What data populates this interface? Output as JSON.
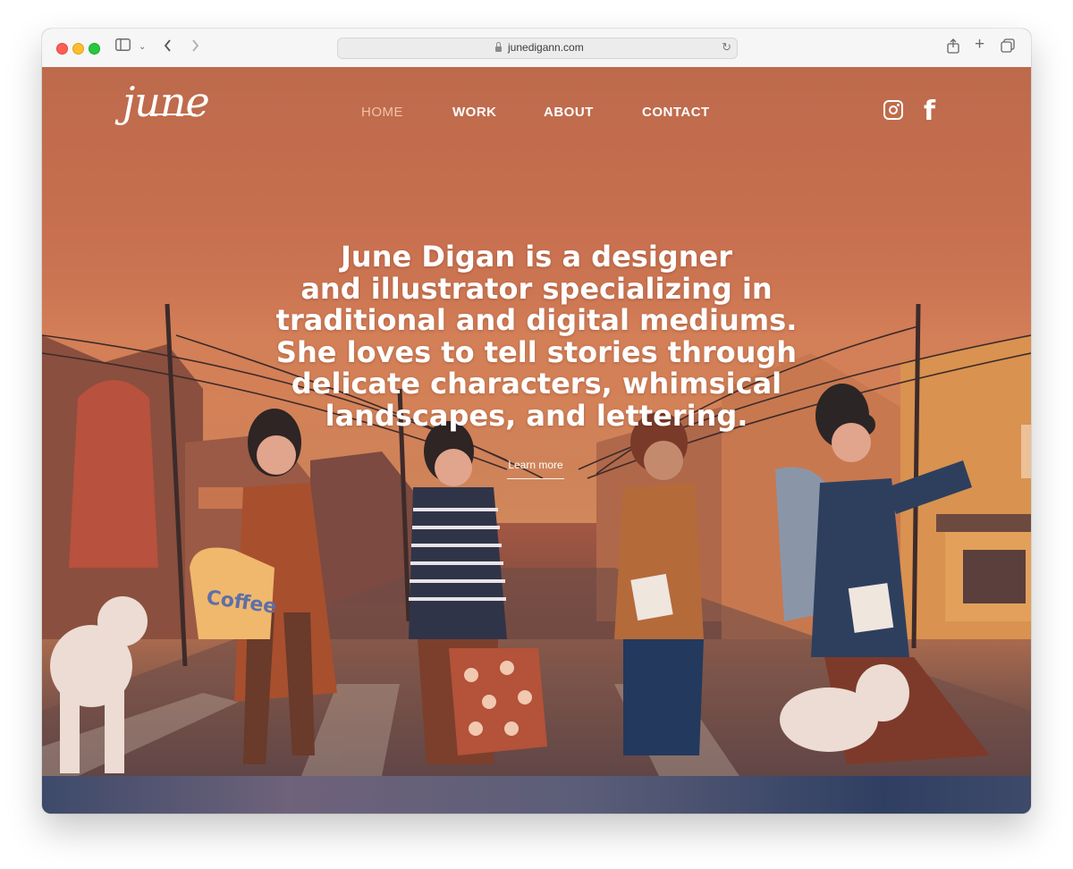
{
  "browser": {
    "url": "junedigann.com",
    "icons": [
      "sidebar-icon",
      "chevron-down-icon",
      "back-icon",
      "forward-icon",
      "lock-icon",
      "reload-icon",
      "share-icon",
      "new-tab-icon",
      "tabs-overview-icon"
    ]
  },
  "site": {
    "logo": "june",
    "nav": {
      "home": "HOME",
      "work": "WORK",
      "about": "ABOUT",
      "contact": "CONTACT"
    },
    "social": [
      "instagram-icon",
      "facebook-icon"
    ],
    "hero": {
      "lines": [
        "June Digan is a designer",
        "and illustrator specializing in",
        "traditional and digital mediums.",
        "She loves to tell stories through",
        "delicate characters, whimsical",
        "landscapes, and lettering."
      ],
      "cta": "Learn more",
      "bag_text": "Coffee"
    },
    "colors": {
      "sky": "#c9724f",
      "text": "#ffffff",
      "nav_active": "#f1c3a8",
      "footer_band": "#3d4a6a"
    }
  }
}
